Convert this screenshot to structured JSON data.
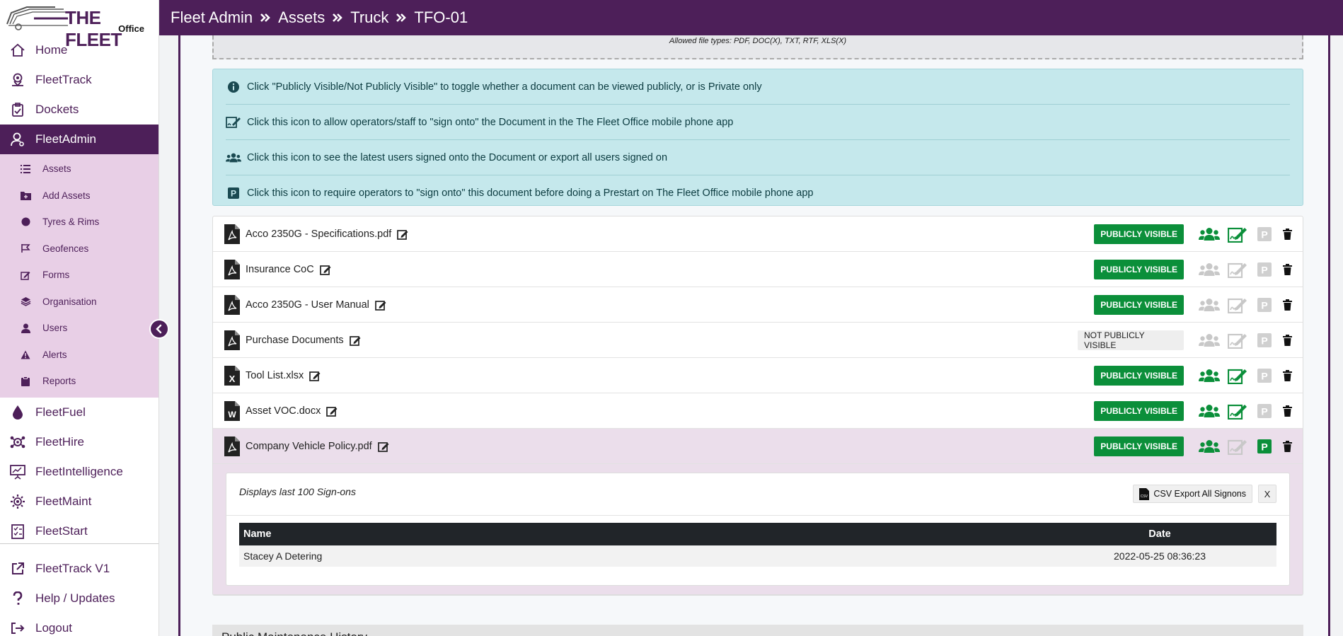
{
  "brand": {
    "name": "THE FLEET",
    "sub": "Office"
  },
  "header": {
    "crumbs": [
      "Fleet Admin",
      "Assets",
      "Truck",
      "TFO-01"
    ]
  },
  "sidebar": {
    "items": [
      {
        "label": "Home",
        "icon": "home-icon"
      },
      {
        "label": "FleetTrack",
        "icon": "map-pin-icon"
      },
      {
        "label": "Dockets",
        "icon": "clipboard-check-icon"
      },
      {
        "label": "FleetAdmin",
        "icon": "user-cog-icon",
        "active": true
      }
    ],
    "subitems": [
      {
        "label": "Assets",
        "icon": "list-icon"
      },
      {
        "label": "Add Assets",
        "icon": "folder-plus-icon"
      },
      {
        "label": "Tyres & Rims",
        "icon": "circle-icon"
      },
      {
        "label": "Geofences",
        "icon": "flag-icon"
      },
      {
        "label": "Forms",
        "icon": "edit-icon"
      },
      {
        "label": "Organisation",
        "icon": "layers-icon"
      },
      {
        "label": "Users",
        "icon": "user-icon"
      },
      {
        "label": "Alerts",
        "icon": "warning-icon"
      },
      {
        "label": "Reports",
        "icon": "clipboard-icon"
      }
    ],
    "items2": [
      {
        "label": "FleetFuel",
        "icon": "drop-icon"
      },
      {
        "label": "FleetHire",
        "icon": "gear-network-icon"
      },
      {
        "label": "FleetIntelligence",
        "icon": "presentation-icon"
      },
      {
        "label": "FleetMaint",
        "icon": "gear-icon"
      },
      {
        "label": "FleetStart",
        "icon": "checklist-icon"
      }
    ],
    "bottom": [
      {
        "label": "FleetTrack V1",
        "icon": "external-link-icon"
      },
      {
        "label": "Help / Updates",
        "icon": "question-icon"
      },
      {
        "label": "Logout",
        "icon": "logout-icon"
      }
    ]
  },
  "dropzone": {
    "text": "Allowed file types: PDF, DOC(X), TXT, RTF, XLS(X)"
  },
  "info": [
    "Click \"Publicly Visible/Not Publicly Visible\" to toggle whether a document can be viewed publicly, or is Private only",
    "Click this icon to allow operators/staff to \"sign onto\" the Document in the The Fleet Office mobile phone app",
    "Click this icon to see the latest users signed onto the Document or export all users signed on",
    "Click this icon to require operators to \"sign onto\" this document before doing a Prestart on The Fleet Office mobile phone app"
  ],
  "documents": [
    {
      "name": "Acco 2350G - Specifications.pdf",
      "type": "pdf",
      "visibility": "PUBLICLY VISIBLE",
      "public": true,
      "users": true,
      "sign": true,
      "prestart": false
    },
    {
      "name": "Insurance CoC",
      "type": "pdf",
      "visibility": "PUBLICLY VISIBLE",
      "public": true,
      "users": false,
      "sign": false,
      "prestart": false
    },
    {
      "name": "Acco 2350G - User Manual",
      "type": "pdf",
      "visibility": "PUBLICLY VISIBLE",
      "public": true,
      "users": false,
      "sign": false,
      "prestart": false
    },
    {
      "name": "Purchase Documents",
      "type": "pdf",
      "visibility": "NOT PUBLICLY VISIBLE",
      "public": false,
      "users": false,
      "sign": false,
      "prestart": false
    },
    {
      "name": "Tool List.xlsx",
      "type": "xls",
      "visibility": "PUBLICLY VISIBLE",
      "public": true,
      "users": true,
      "sign": true,
      "prestart": false
    },
    {
      "name": "Asset VOC.docx",
      "type": "doc",
      "visibility": "PUBLICLY VISIBLE",
      "public": true,
      "users": true,
      "sign": true,
      "prestart": false
    },
    {
      "name": "Company Vehicle Policy.pdf",
      "type": "pdf",
      "visibility": "PUBLICLY VISIBLE",
      "public": true,
      "users": true,
      "sign": false,
      "prestart": true,
      "selected": true
    }
  ],
  "signons": {
    "label": "Displays last 100 Sign-ons",
    "csv_label": "CSV Export All Signons",
    "close_label": "X",
    "columns": [
      "Name",
      "Date"
    ],
    "rows": [
      {
        "name": "Stacey A Detering",
        "date": "2022-05-25 08:36:23"
      }
    ]
  },
  "maintenance": {
    "title": "Public Maintenance History"
  },
  "colors": {
    "brand": "#4d1f59",
    "green": "#0b8f3a",
    "disabled": "#c8c8c8",
    "info_bg": "#c5e8ec"
  }
}
